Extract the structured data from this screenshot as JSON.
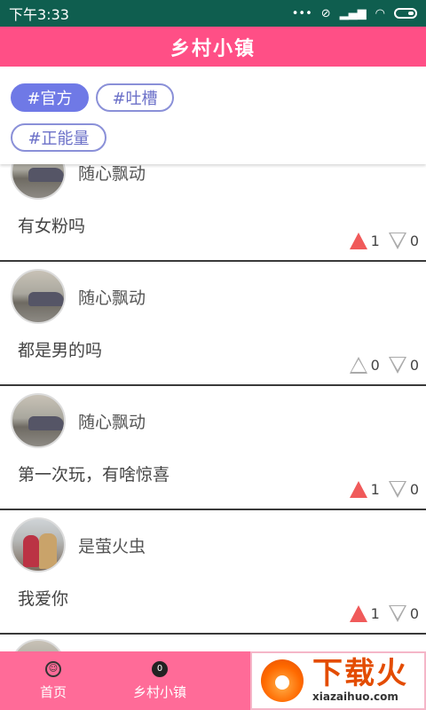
{
  "status_bar": {
    "time": "下午3:33",
    "icons": [
      "more-dots-icon",
      "mute-icon",
      "signal-icon",
      "wifi-icon",
      "battery-icon"
    ]
  },
  "app_bar": {
    "title": "乡村小镇"
  },
  "tags": [
    {
      "label": "#官方",
      "active": true
    },
    {
      "label": "#吐槽",
      "active": false
    },
    {
      "label": "#正能量",
      "active": false
    }
  ],
  "posts": [
    {
      "username": "随心飘动",
      "content": "有女粉吗",
      "up": "1",
      "down": "0",
      "up_active": true
    },
    {
      "username": "随心飘动",
      "content": "都是男的吗",
      "up": "0",
      "down": "0",
      "up_active": false
    },
    {
      "username": "随心飘动",
      "content": "第一次玩，有啥惊喜",
      "up": "1",
      "down": "0",
      "up_active": true
    },
    {
      "username": "是萤火虫",
      "content": "我爱你",
      "up": "1",
      "down": "0",
      "up_active": true
    }
  ],
  "bottom_nav": {
    "items": [
      {
        "label": "首页",
        "icon": "smile-icon"
      },
      {
        "label": "乡村小镇",
        "icon": "eye-icon"
      }
    ]
  },
  "watermark": {
    "text_big": "下载火",
    "text_small": "xiazaihuo.com"
  },
  "colors": {
    "status_bar": "#0f5e4f",
    "accent": "#ff4f86",
    "tag_active": "#6f79e6",
    "up_vote": "#f05a5a"
  }
}
